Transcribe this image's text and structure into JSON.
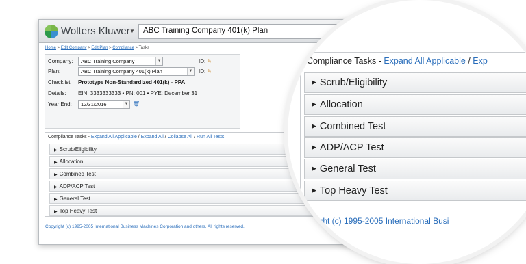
{
  "header": {
    "brand": "Wolters Kluwer",
    "plan_name": "ABC Training Company 401(k) Plan"
  },
  "breadcrumb": {
    "items": [
      "Home",
      "Edit Company",
      "Edit Plan",
      "Compliance"
    ],
    "current": "Tasks",
    "separator": " > "
  },
  "info": {
    "company_label": "Company:",
    "company_value": "ABC Training Company",
    "plan_label": "Plan:",
    "plan_value": "ABC Training Company 401(k) Plan",
    "id_label": "ID:",
    "checklist_label": "Checklist:",
    "checklist_value": "Prototype Non-Standardized 401(k) - PPA",
    "details_label": "Details:",
    "details_value": "EIN: 3333333333 • PN: 001 • PYE: December 31",
    "year_end_label": "Year End:",
    "year_end_value": "12/31/2016"
  },
  "tasks": {
    "title": "Compliance Tasks - ",
    "expand_all_applicable": "Expand All Applicable",
    "expand_all": "Expand All",
    "collapse_all": "Collapse All",
    "run_all_tests": "Run All Tests!",
    "separator": " / ",
    "rows": [
      "Scrub/Eligibility",
      "Allocation",
      "Combined Test",
      "ADP/ACP Test",
      "General Test",
      "Top Heavy Test"
    ]
  },
  "footer": {
    "copyright": "Copyright (c) 1995-2005 International Business Machines Corporation and others. All rights reserved."
  },
  "magnifier": {
    "header_title": "Compliance Tasks - ",
    "header_link": "Expand All Applicable",
    "header_sep": " / ",
    "header_trunc": "Exp",
    "copyright_fragment": "yright (c) 1995-2005 International Busi"
  },
  "icons": {
    "pencil": "pencil-icon",
    "trash": "trash-icon",
    "expand": "triangle-right-icon",
    "dropdown": "chevron-down-icon"
  },
  "colors": {
    "link": "#2a6ebb",
    "topbar": "#dcdfe2",
    "panel": "#f4f5f6"
  }
}
